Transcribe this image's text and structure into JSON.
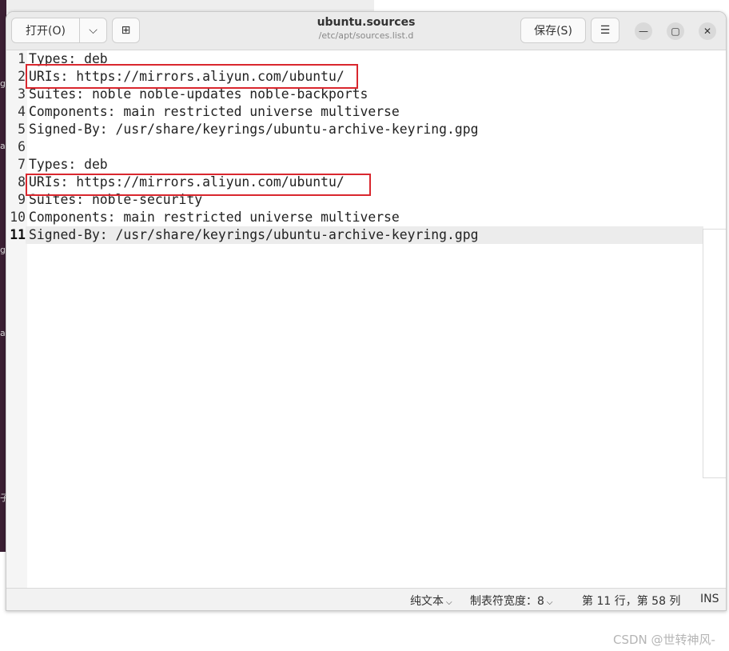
{
  "window": {
    "title": "ubuntu.sources",
    "subtitle": "/etc/apt/sources.list.d"
  },
  "header": {
    "open_label": "打开(O)",
    "open_dropdown_icon": "chevron-down-icon",
    "new_tab_icon": "new-tab-icon",
    "save_label": "保存(S)",
    "menu_icon": "hamburger-menu-icon",
    "minimize_glyph": "—",
    "maximize_glyph": "▢",
    "close_glyph": "✕",
    "open_dropdown_glyph": "⌵",
    "new_tab_glyph": "⊞",
    "menu_glyph": "☰"
  },
  "editor": {
    "lines": [
      {
        "num": "1",
        "text": "Types: deb"
      },
      {
        "num": "2",
        "text": "URIs: https://mirrors.aliyun.com/ubuntu/"
      },
      {
        "num": "3",
        "text": "Suites: noble noble-updates noble-backports"
      },
      {
        "num": "4",
        "text": "Components: main restricted universe multiverse"
      },
      {
        "num": "5",
        "text": "Signed-By: /usr/share/keyrings/ubuntu-archive-keyring.gpg"
      },
      {
        "num": "6",
        "text": ""
      },
      {
        "num": "7",
        "text": "Types: deb"
      },
      {
        "num": "8",
        "text": "URIs: https://mirrors.aliyun.com/ubuntu/"
      },
      {
        "num": "9",
        "text": "Suites: noble-security"
      },
      {
        "num": "10",
        "text": "Components: main restricted universe multiverse"
      },
      {
        "num": "11",
        "text": "Signed-By: /usr/share/keyrings/ubuntu-archive-keyring.gpg"
      }
    ],
    "current_line": 11
  },
  "status": {
    "language": "纯文本",
    "tab_width_label": "制表符宽度：",
    "tab_width_value": "8",
    "position": "第 11 行，第 58 列",
    "mode": "INS"
  },
  "desktop": {
    "edge_glyphs": [
      "g",
      "a",
      "g",
      "a",
      "子"
    ]
  },
  "watermark": "CSDN @世转神风-",
  "colors": {
    "highlight_box": "#d9272e",
    "headerbar": "#ebebeb",
    "current_line": "#ececec"
  }
}
